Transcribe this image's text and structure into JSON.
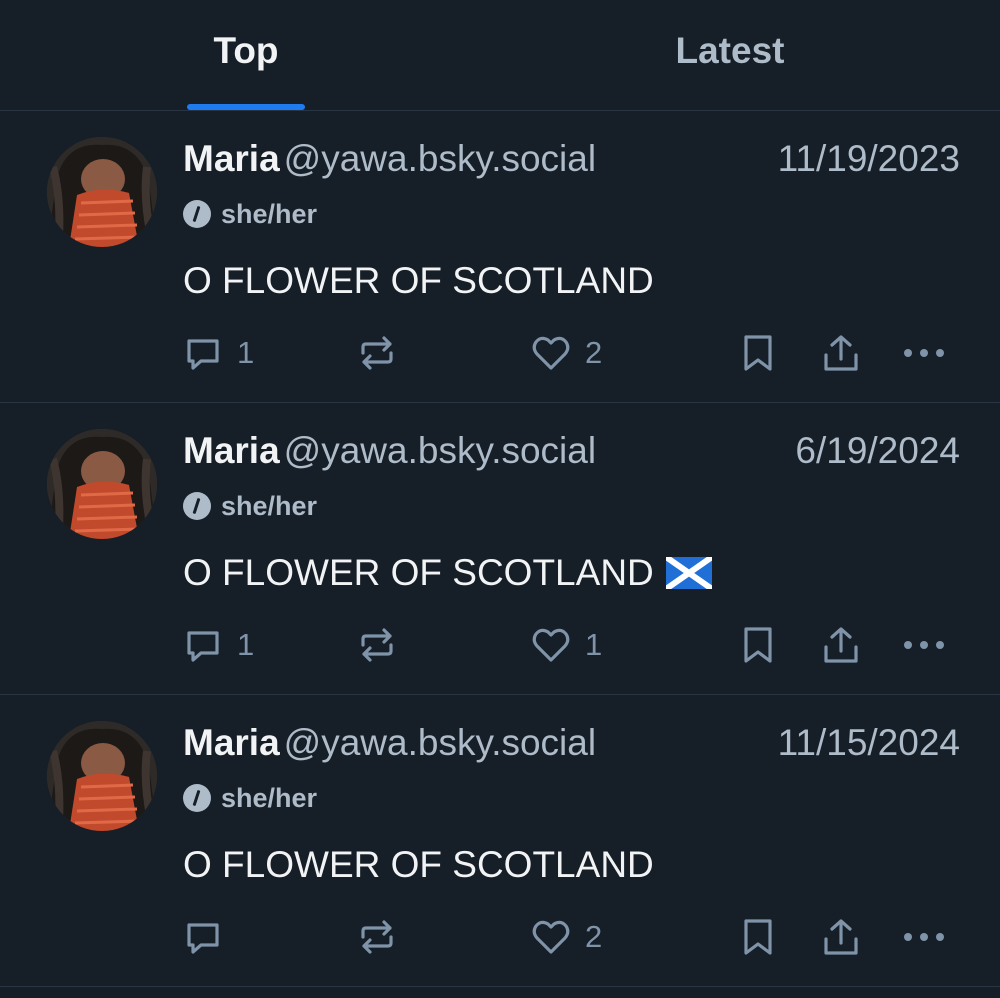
{
  "tabs": [
    {
      "label": "Top",
      "active": true
    },
    {
      "label": "Latest",
      "active": false
    }
  ],
  "colors": {
    "background": "#161e27",
    "accent": "#1e7bf0",
    "muted_text": "#aebbc9",
    "icon": "#7f93a9"
  },
  "posts": [
    {
      "author": {
        "name": "Maria",
        "handle": "@yawa.bsky.social",
        "pronouns": "she/her",
        "avatar": "avatar-photo"
      },
      "date": "11/19/2023",
      "text": "O FLOWER OF SCOTLAND",
      "emoji": "",
      "reply_count": "1",
      "repost_count": "",
      "like_count": "2"
    },
    {
      "author": {
        "name": "Maria",
        "handle": "@yawa.bsky.social",
        "pronouns": "she/her",
        "avatar": "avatar-photo"
      },
      "date": "6/19/2024",
      "text": "O FLOWER OF SCOTLAND",
      "emoji": "scotland-flag",
      "reply_count": "1",
      "repost_count": "",
      "like_count": "1"
    },
    {
      "author": {
        "name": "Maria",
        "handle": "@yawa.bsky.social",
        "pronouns": "she/her",
        "avatar": "avatar-photo"
      },
      "date": "11/15/2024",
      "text": "O FLOWER OF SCOTLAND",
      "emoji": "",
      "reply_count": "",
      "repost_count": "",
      "like_count": "2"
    }
  ]
}
